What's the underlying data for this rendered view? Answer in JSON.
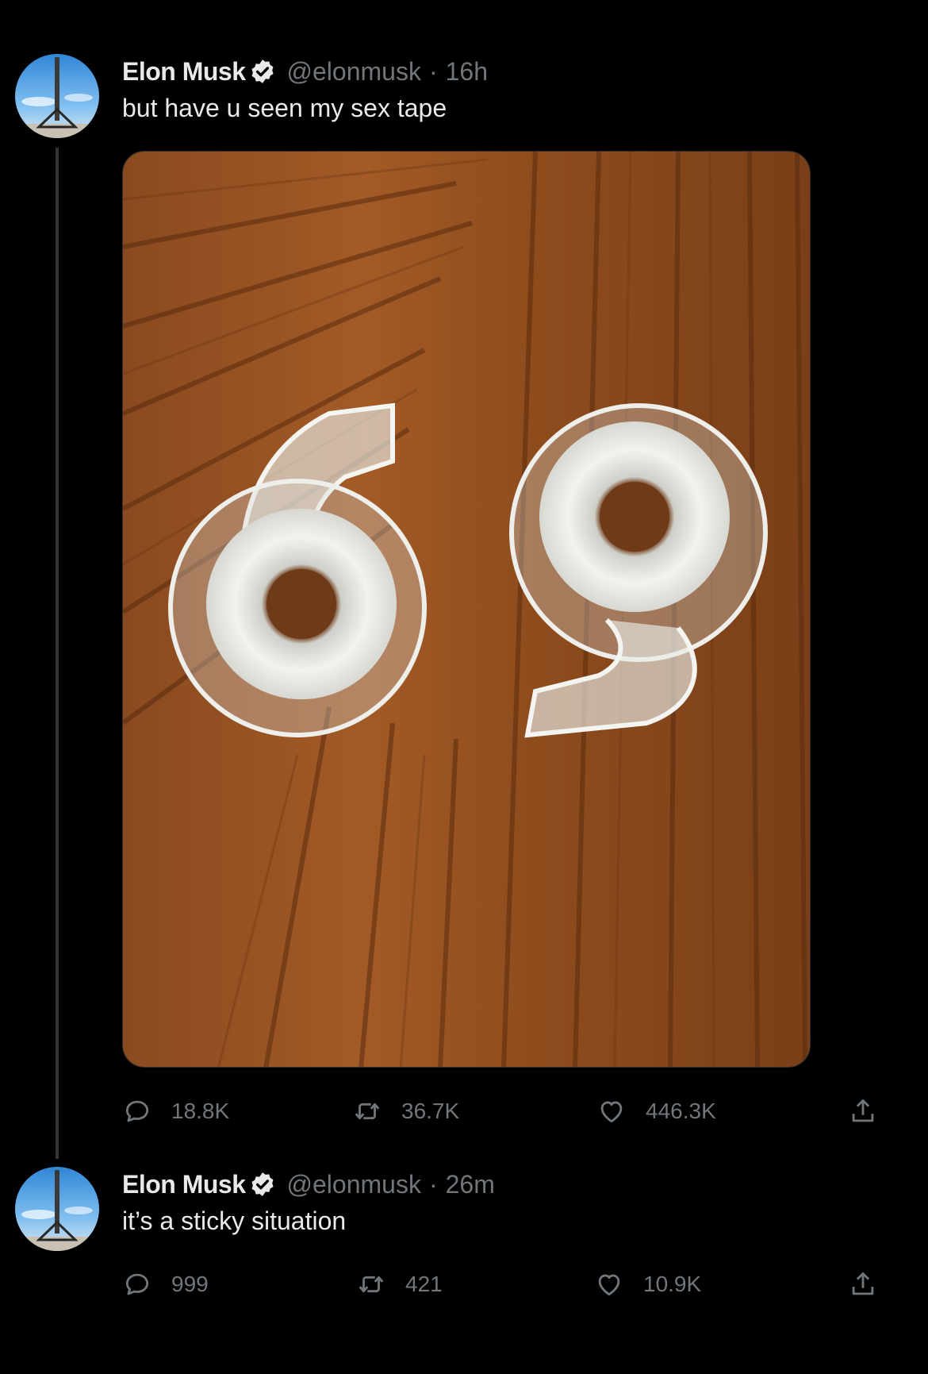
{
  "tweets": [
    {
      "name": "Elon Musk",
      "handle": "@elonmusk",
      "separator": "·",
      "time": "16h",
      "text": "but have u seen my sex tape",
      "replies": "18.8K",
      "retweets": "36.7K",
      "likes": "446.3K",
      "media": "photo of two clear tape dispensers arranged as 69 on a wooden table"
    },
    {
      "name": "Elon Musk",
      "handle": "@elonmusk",
      "separator": "·",
      "time": "26m",
      "text": "it’s a sticky situation",
      "replies": "999",
      "retweets": "421",
      "likes": "10.9K"
    }
  ],
  "colors": {
    "background": "#000000",
    "primary_text": "#e7e9ea",
    "secondary_text": "#71767b",
    "verified_badge": "#e7e9ea",
    "thread_line": "#333639"
  },
  "icons": {
    "verified": "verified-badge-icon",
    "reply": "reply-icon",
    "retweet": "retweet-icon",
    "like": "heart-icon",
    "share": "share-icon"
  }
}
